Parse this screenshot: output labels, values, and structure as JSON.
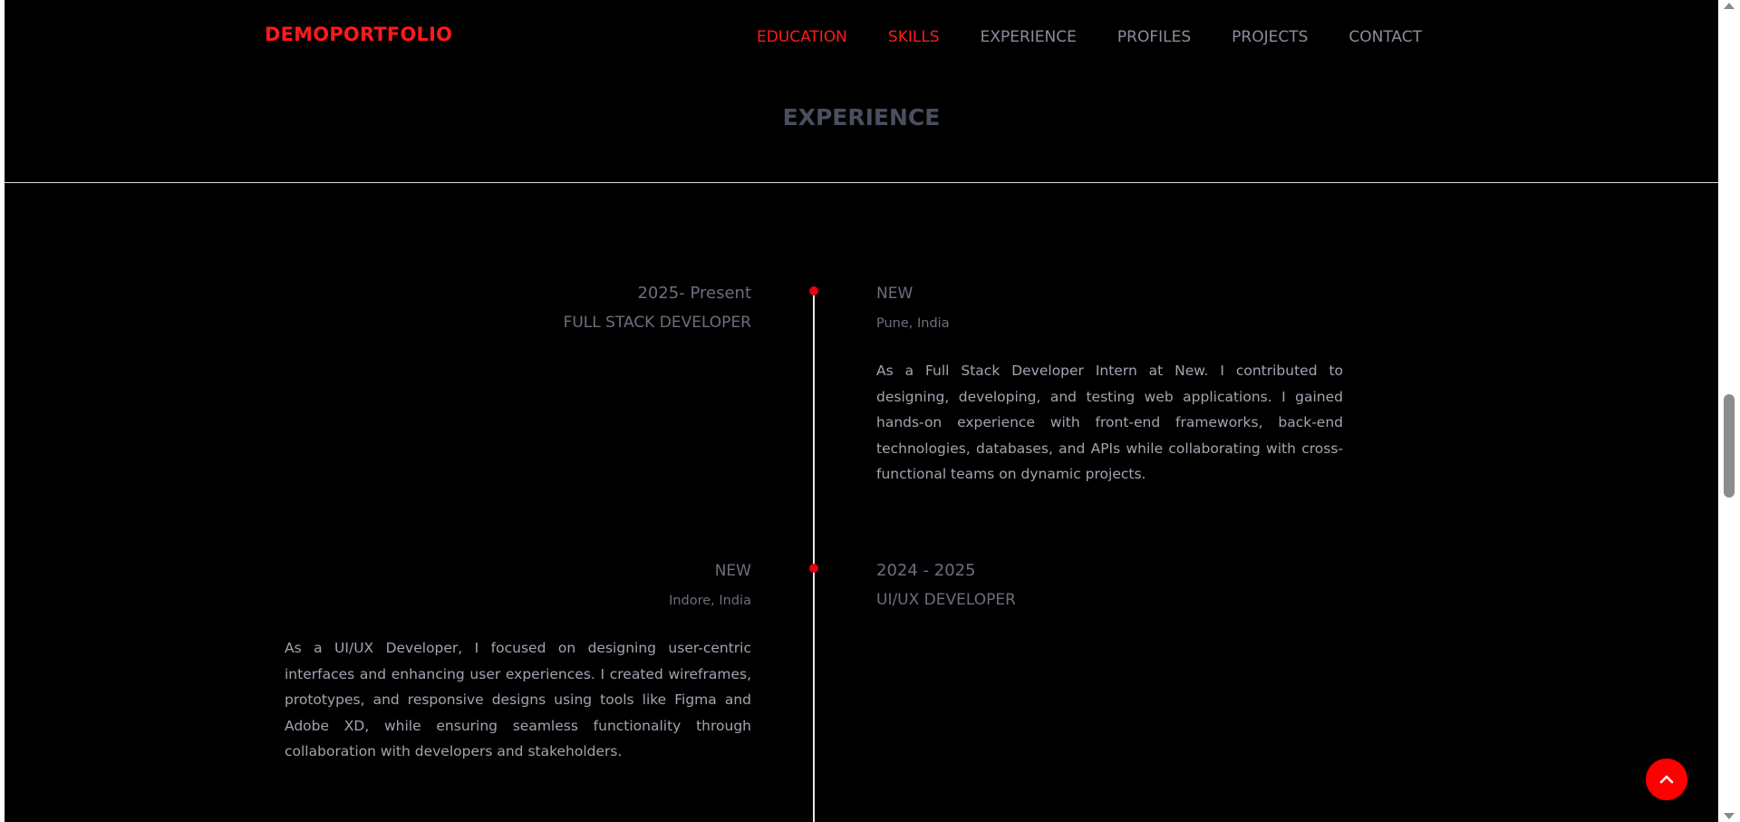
{
  "header": {
    "logo": "DEMOPORTFOLIO",
    "nav": [
      {
        "label": "EDUCATION",
        "active": true
      },
      {
        "label": "SKILLS",
        "active": true
      },
      {
        "label": "EXPERIENCE",
        "active": false
      },
      {
        "label": "PROFILES",
        "active": false
      },
      {
        "label": "PROJECTS",
        "active": false
      },
      {
        "label": "CONTACT",
        "active": false
      }
    ]
  },
  "section": {
    "title": "EXPERIENCE"
  },
  "timeline": [
    {
      "date": "2025- Present",
      "role": "FULL STACK DEVELOPER",
      "company": "NEW",
      "location": "Pune, India",
      "description": "As a Full Stack Developer Intern at New. I contributed to designing, developing, and testing web applications. I gained hands-on experience with front-end frameworks, back-end technologies, databases, and APIs while collaborating with cross-functional teams on dynamic projects."
    },
    {
      "date": "2024 - 2025",
      "role": "UI/UX DEVELOPER",
      "company": "NEW",
      "location": "Indore, India",
      "description": "As a UI/UX Developer, I focused on designing user-centric interfaces and enhancing user experiences. I created wireframes, prototypes, and responsive designs using tools like Figma and Adobe XD, while ensuring seamless functionality through collaboration with developers and stakeholders."
    }
  ],
  "colors": {
    "accent": "#ff1a1a",
    "background": "#000000",
    "muted_text": "#6b6f7c",
    "body_text": "#a2a5b0",
    "timeline_dot": "#e60012"
  },
  "icons": {
    "scroll_top": "chevron-up-icon"
  }
}
